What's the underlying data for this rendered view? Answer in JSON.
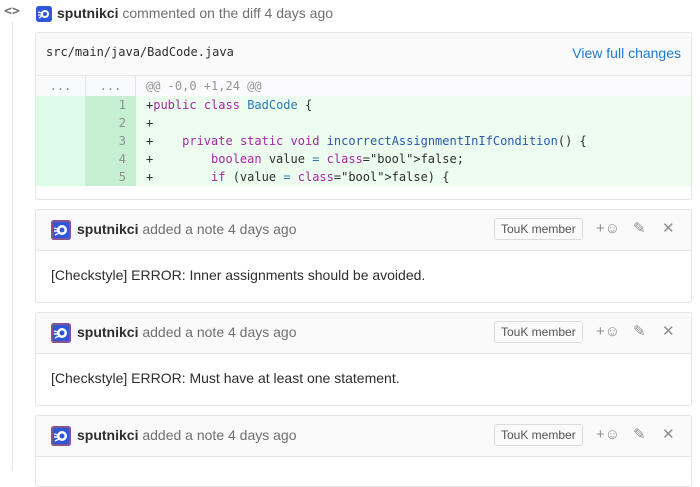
{
  "discussion": {
    "author": "sputnikci",
    "action_text": "commented on the diff",
    "time": "4 days ago"
  },
  "diff": {
    "file_path": "src/main/java/BadCode.java",
    "view_full_label": "View full changes",
    "hunk": {
      "old_ln": "...",
      "new_ln": "...",
      "header": "@@ -0,0 +1,24 @@"
    },
    "lines": [
      {
        "new_ln": "1",
        "code": "+public class BadCode {"
      },
      {
        "new_ln": "2",
        "code": "+"
      },
      {
        "new_ln": "3",
        "code": "+    private static void incorrectAssignmentInIfCondition() {"
      },
      {
        "new_ln": "4",
        "code": "+        boolean value = false;"
      },
      {
        "new_ln": "5",
        "code": "+        if (value = false) {"
      }
    ]
  },
  "notes": [
    {
      "author": "sputnikci",
      "action": "added a note",
      "time": "4 days ago",
      "badge": "TouK member",
      "body": "[Checkstyle] ERROR: Inner assignments should be avoided."
    },
    {
      "author": "sputnikci",
      "action": "added a note",
      "time": "4 days ago",
      "badge": "TouK member",
      "body": "[Checkstyle] ERROR: Must have at least one statement."
    },
    {
      "author": "sputnikci",
      "action": "added a note",
      "time": "4 days ago",
      "badge": "TouK member",
      "body": ""
    }
  ],
  "icons": {
    "discussion": "code-diff-icon",
    "add_reaction": "add-emoji-icon",
    "edit": "pencil-icon",
    "delete": "close-icon"
  },
  "colors": {
    "link": "#1f78d1",
    "added_line_bg": "#ecfdf0",
    "added_ln_bg": "#ddfbe6",
    "avatar": "#2f58d8"
  }
}
